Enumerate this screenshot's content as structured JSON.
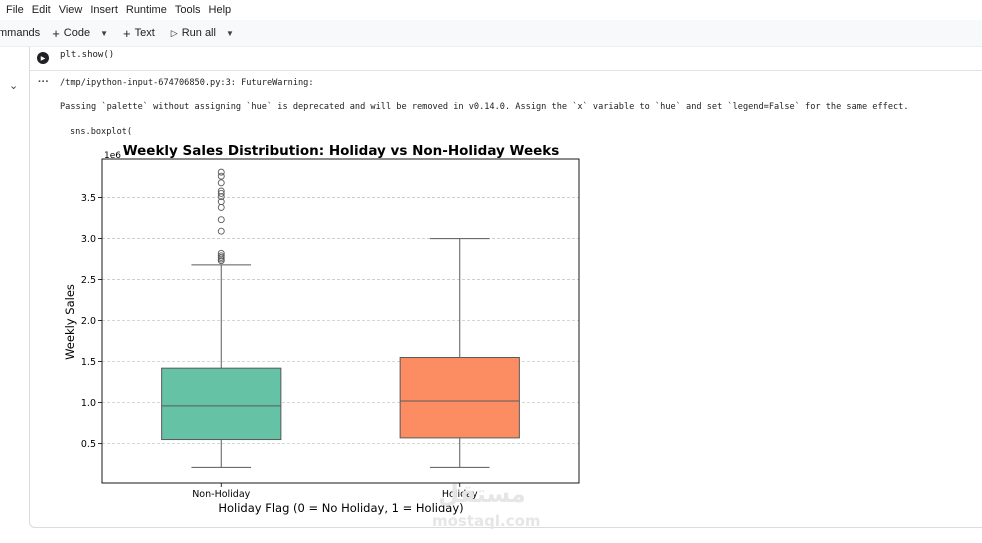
{
  "menu": {
    "items": [
      "File",
      "Edit",
      "View",
      "Insert",
      "Runtime",
      "Tools",
      "Help"
    ]
  },
  "toolbar": {
    "commands_label": "mmands",
    "add_code_label": "Code",
    "add_text_label": "Text",
    "run_all_label": "Run all"
  },
  "cell": {
    "code_line": "plt.show()"
  },
  "output": {
    "warning_path": "/tmp/ipython-input-674706850.py:3: FutureWarning:",
    "warning_message": "Passing `palette` without assigning `hue` is deprecated and will be removed in v0.14.0. Assign the `x` variable to `hue` and set `legend=False` for the same effect.",
    "code_snippet": "sns.boxplot("
  },
  "watermark": {
    "text_arabic": "مستقل",
    "text_latin": "mostaql.com"
  },
  "chart_data": {
    "type": "boxplot",
    "title": "Weekly Sales Distribution: Holiday vs Non-Holiday Weeks",
    "xlabel": "Holiday Flag (0 = No Holiday, 1 = Holiday)",
    "ylabel": "Weekly Sales",
    "y_offset_label": "1e6",
    "ylim": [
      0.02,
      3.97
    ],
    "yticks": [
      0.5,
      1.0,
      1.5,
      2.0,
      2.5,
      3.0,
      3.5
    ],
    "ytick_labels": [
      "0.5",
      "1.0",
      "1.5",
      "2.0",
      "2.5",
      "3.0",
      "3.5"
    ],
    "grid": "horizontal dashed",
    "categories": [
      "Non-Holiday",
      "Holiday"
    ],
    "colors": [
      "#66c2a5",
      "#fc8d62"
    ],
    "boxes": [
      {
        "category": "Non-Holiday",
        "whisker_low": 0.21,
        "q1": 0.55,
        "median": 0.96,
        "q3": 1.42,
        "whisker_high": 2.68,
        "outliers": [
          2.73,
          2.75,
          2.77,
          2.79,
          2.82,
          3.09,
          3.23,
          3.38,
          3.45,
          3.51,
          3.55,
          3.58,
          3.68,
          3.76,
          3.81
        ]
      },
      {
        "category": "Holiday",
        "whisker_low": 0.21,
        "q1": 0.57,
        "median": 1.02,
        "q3": 1.55,
        "whisker_high": 3.0,
        "outliers": []
      }
    ]
  }
}
